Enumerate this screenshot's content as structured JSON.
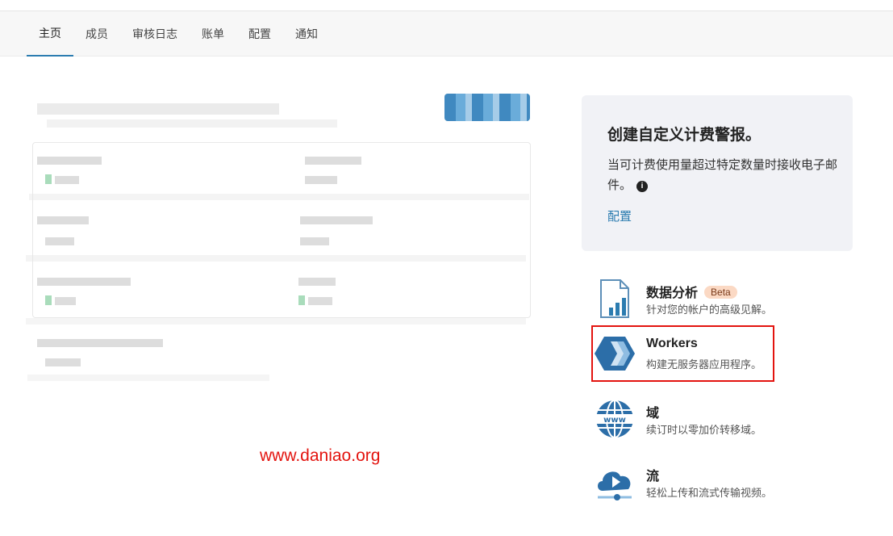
{
  "nav": {
    "tabs": [
      {
        "label": "主页",
        "active": true
      },
      {
        "label": "成员",
        "active": false
      },
      {
        "label": "审核日志",
        "active": false
      },
      {
        "label": "账单",
        "active": false
      },
      {
        "label": "配置",
        "active": false
      },
      {
        "label": "通知",
        "active": false
      }
    ]
  },
  "watermark": "www.daniao.org",
  "alert_card": {
    "title": "创建自定义计费警报。",
    "description": "当可计费使用量超过特定数量时接收电子邮件。",
    "link": "配置"
  },
  "products": [
    {
      "title": "数据分析",
      "badge": "Beta",
      "description": "针对您的帐户的高级见解。",
      "icon": "analytics-icon"
    },
    {
      "title": "Workers",
      "badge": "",
      "description": "构建无服务器应用程序。",
      "icon": "workers-icon"
    },
    {
      "title": "域",
      "badge": "",
      "description": "续订时以零加价转移域。",
      "icon": "globe-www-icon"
    },
    {
      "title": "流",
      "badge": "",
      "description": "轻松上传和流式传输视频。",
      "icon": "cloud-play-icon"
    }
  ],
  "colors": {
    "accent": "#2c7cb0",
    "highlight": "#e3140f",
    "badge_bg": "#fbd9c4"
  }
}
